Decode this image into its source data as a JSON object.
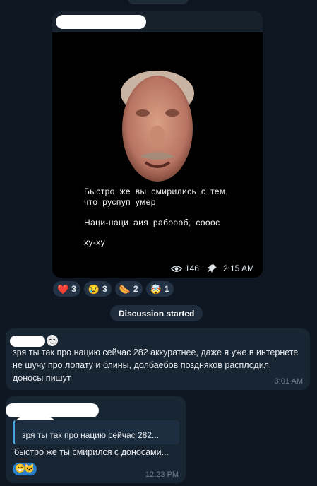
{
  "post": {
    "caption_line1": "Быстро же вы смирились с тем,",
    "caption_line2": "что руспуп умер",
    "caption_line3": "Наци-наци аия рабоооб, сооос",
    "caption_line4": "ху-ху",
    "views": "146",
    "time": "2:15 AM"
  },
  "reactions": [
    {
      "emoji": "❤️",
      "count": "3"
    },
    {
      "emoji": "😢",
      "count": "3"
    },
    {
      "emoji": "🌭",
      "count": "2"
    },
    {
      "emoji": "🤯",
      "count": "1"
    }
  ],
  "system": {
    "discussion": "Discussion started"
  },
  "comments": [
    {
      "text": "зря ты так про нацию сейчас 282 аккуратнее, даже я уже в интернете не шучу про лопату и блины, долбаебов поздняков расплодил доносы пишут",
      "time": "3:01 AM"
    },
    {
      "quote": "зря ты так про нацию сейчас 282...",
      "text": "быстро же ты смирился с доносами...",
      "time": "12:23 PM",
      "reaction_emojis": "😁🐱"
    }
  ],
  "colors": {
    "background": "#0e1621",
    "bubble": "#182533",
    "accent": "#4aa3d8"
  }
}
